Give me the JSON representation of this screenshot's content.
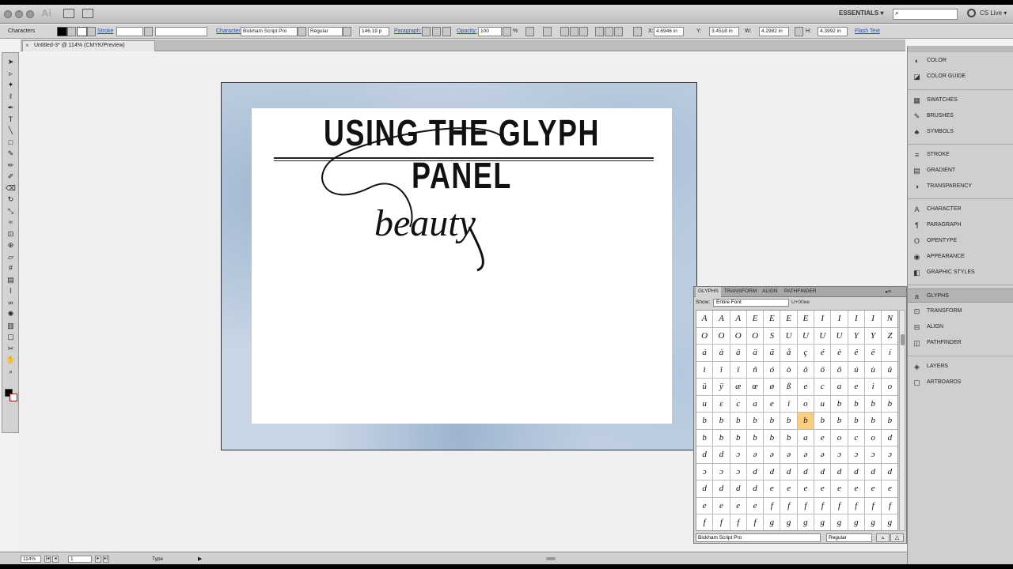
{
  "appbar": {
    "logo": "Ai",
    "workspace": "ESSENTIALS ▾",
    "search_placeholder": "",
    "cslive": "CS Live ▾"
  },
  "control": {
    "panel_label": "Characters",
    "stroke_label": "Stroke",
    "character_link": "Character:",
    "font_name": "Bickham Script Pro",
    "font_style": "Regular",
    "font_size": "146.19 p",
    "paragraph_link": "Paragraph:",
    "opacity_label": "Opacity:",
    "opacity_value": "100",
    "opacity_unit": "%",
    "x_label": "X:",
    "x_value": "4.6946 in",
    "y_label": "Y:",
    "y_value": "3.4518 in",
    "w_label": "W:",
    "w_value": "4.2982 in",
    "h_label": "H:",
    "h_value": "4.3992 in",
    "flash_text": "Flash Text"
  },
  "document": {
    "tab_title": "Untitled-3* @ 114% (CMYK/Preview)",
    "close": "×"
  },
  "artwork": {
    "heading": "USING THE GLYPH PANEL",
    "script_word": "beauty"
  },
  "dock": {
    "items": [
      {
        "label": "COLOR",
        "icon": "color-icon"
      },
      {
        "label": "COLOR GUIDE",
        "icon": "color-guide-icon"
      },
      {
        "label": "SWATCHES",
        "icon": "swatches-icon"
      },
      {
        "label": "BRUSHES",
        "icon": "brushes-icon"
      },
      {
        "label": "SYMBOLS",
        "icon": "symbols-icon"
      },
      {
        "label": "STROKE",
        "icon": "stroke-icon"
      },
      {
        "label": "GRADIENT",
        "icon": "gradient-icon"
      },
      {
        "label": "TRANSPARENCY",
        "icon": "transparency-icon"
      },
      {
        "label": "CHARACTER",
        "icon": "character-icon"
      },
      {
        "label": "PARAGRAPH",
        "icon": "paragraph-icon"
      },
      {
        "label": "OPENTYPE",
        "icon": "opentype-icon"
      },
      {
        "label": "APPEARANCE",
        "icon": "appearance-icon"
      },
      {
        "label": "GRAPHIC STYLES",
        "icon": "graphic-styles-icon"
      },
      {
        "label": "GLYPHS",
        "icon": "glyphs-icon"
      },
      {
        "label": "TRANSFORM",
        "icon": "transform-icon"
      },
      {
        "label": "ALIGN",
        "icon": "align-icon"
      },
      {
        "label": "PATHFINDER",
        "icon": "pathfinder-icon"
      },
      {
        "label": "LAYERS",
        "icon": "layers-icon"
      },
      {
        "label": "ARTBOARDS",
        "icon": "artboards-icon"
      }
    ]
  },
  "glyphs_panel": {
    "tabs": [
      "GLYPHS",
      "TRANSFORM",
      "ALIGN",
      "PATHFINDER"
    ],
    "show_label": "Show:",
    "show_value": "Entire Font",
    "unicode": "U+00ee",
    "font": "Bickham Script Pro",
    "style": "Regular",
    "glyphs": [
      "A",
      "A",
      "A",
      "E",
      "E",
      "E",
      "E",
      "I",
      "I",
      "I",
      "I",
      "N",
      "O",
      "O",
      "O",
      "O",
      "S",
      "U",
      "U",
      "U",
      "U",
      "Y",
      "Y",
      "Z",
      "á",
      "à",
      "â",
      "ä",
      "ã",
      "å",
      "ç",
      "é",
      "è",
      "ê",
      "ë",
      "í",
      "ì",
      "î",
      "ï",
      "ñ",
      "ó",
      "ò",
      "ô",
      "ö",
      "õ",
      "ú",
      "ù",
      "û",
      "ü",
      "ÿ",
      "æ",
      "œ",
      "ø",
      "ß",
      "e",
      "c",
      "a",
      "e",
      "i",
      "o",
      "u",
      "ε",
      "c",
      "a",
      "e",
      "i",
      "o",
      "u",
      "b",
      "b",
      "b",
      "b",
      "b",
      "b",
      "b",
      "b",
      "b",
      "b",
      "b",
      "b",
      "b",
      "b",
      "b",
      "b",
      "b",
      "b",
      "b",
      "b",
      "b",
      "b",
      "a",
      "e",
      "o",
      "c",
      "o",
      "d",
      "d",
      "d",
      "ɔ",
      "ə",
      "ə",
      "ə",
      "ə",
      "ə",
      "ɔ",
      "ɔ",
      "ɔ",
      "ɔ",
      "ɔ",
      "ɔ",
      "ɔ",
      "d",
      "d",
      "d",
      "d",
      "d",
      "d",
      "d",
      "d",
      "d",
      "d",
      "d",
      "d",
      "d",
      "e",
      "e",
      "e",
      "e",
      "e",
      "e",
      "e",
      "e",
      "e",
      "e",
      "e",
      "e",
      "f",
      "f",
      "f",
      "f",
      "f",
      "f",
      "f",
      "f",
      "f",
      "f",
      "f",
      "f",
      "g",
      "g",
      "g",
      "g",
      "g",
      "g",
      "g",
      "g",
      "g",
      "g",
      "g",
      "g"
    ],
    "selected_index": 78
  },
  "status": {
    "zoom": "114%",
    "page": "1",
    "type": "Type"
  },
  "tools": [
    "selection",
    "direct-selection",
    "magic-wand",
    "lasso",
    "pen",
    "type",
    "line",
    "rectangle",
    "paintbrush",
    "pencil",
    "blob-brush",
    "eraser",
    "rotate",
    "scale",
    "warp",
    "free-transform",
    "shape-builder",
    "perspective",
    "mesh",
    "gradient",
    "eyedropper",
    "blend",
    "symbol-sprayer",
    "column-graph",
    "artboard",
    "slice",
    "hand",
    "zoom"
  ]
}
